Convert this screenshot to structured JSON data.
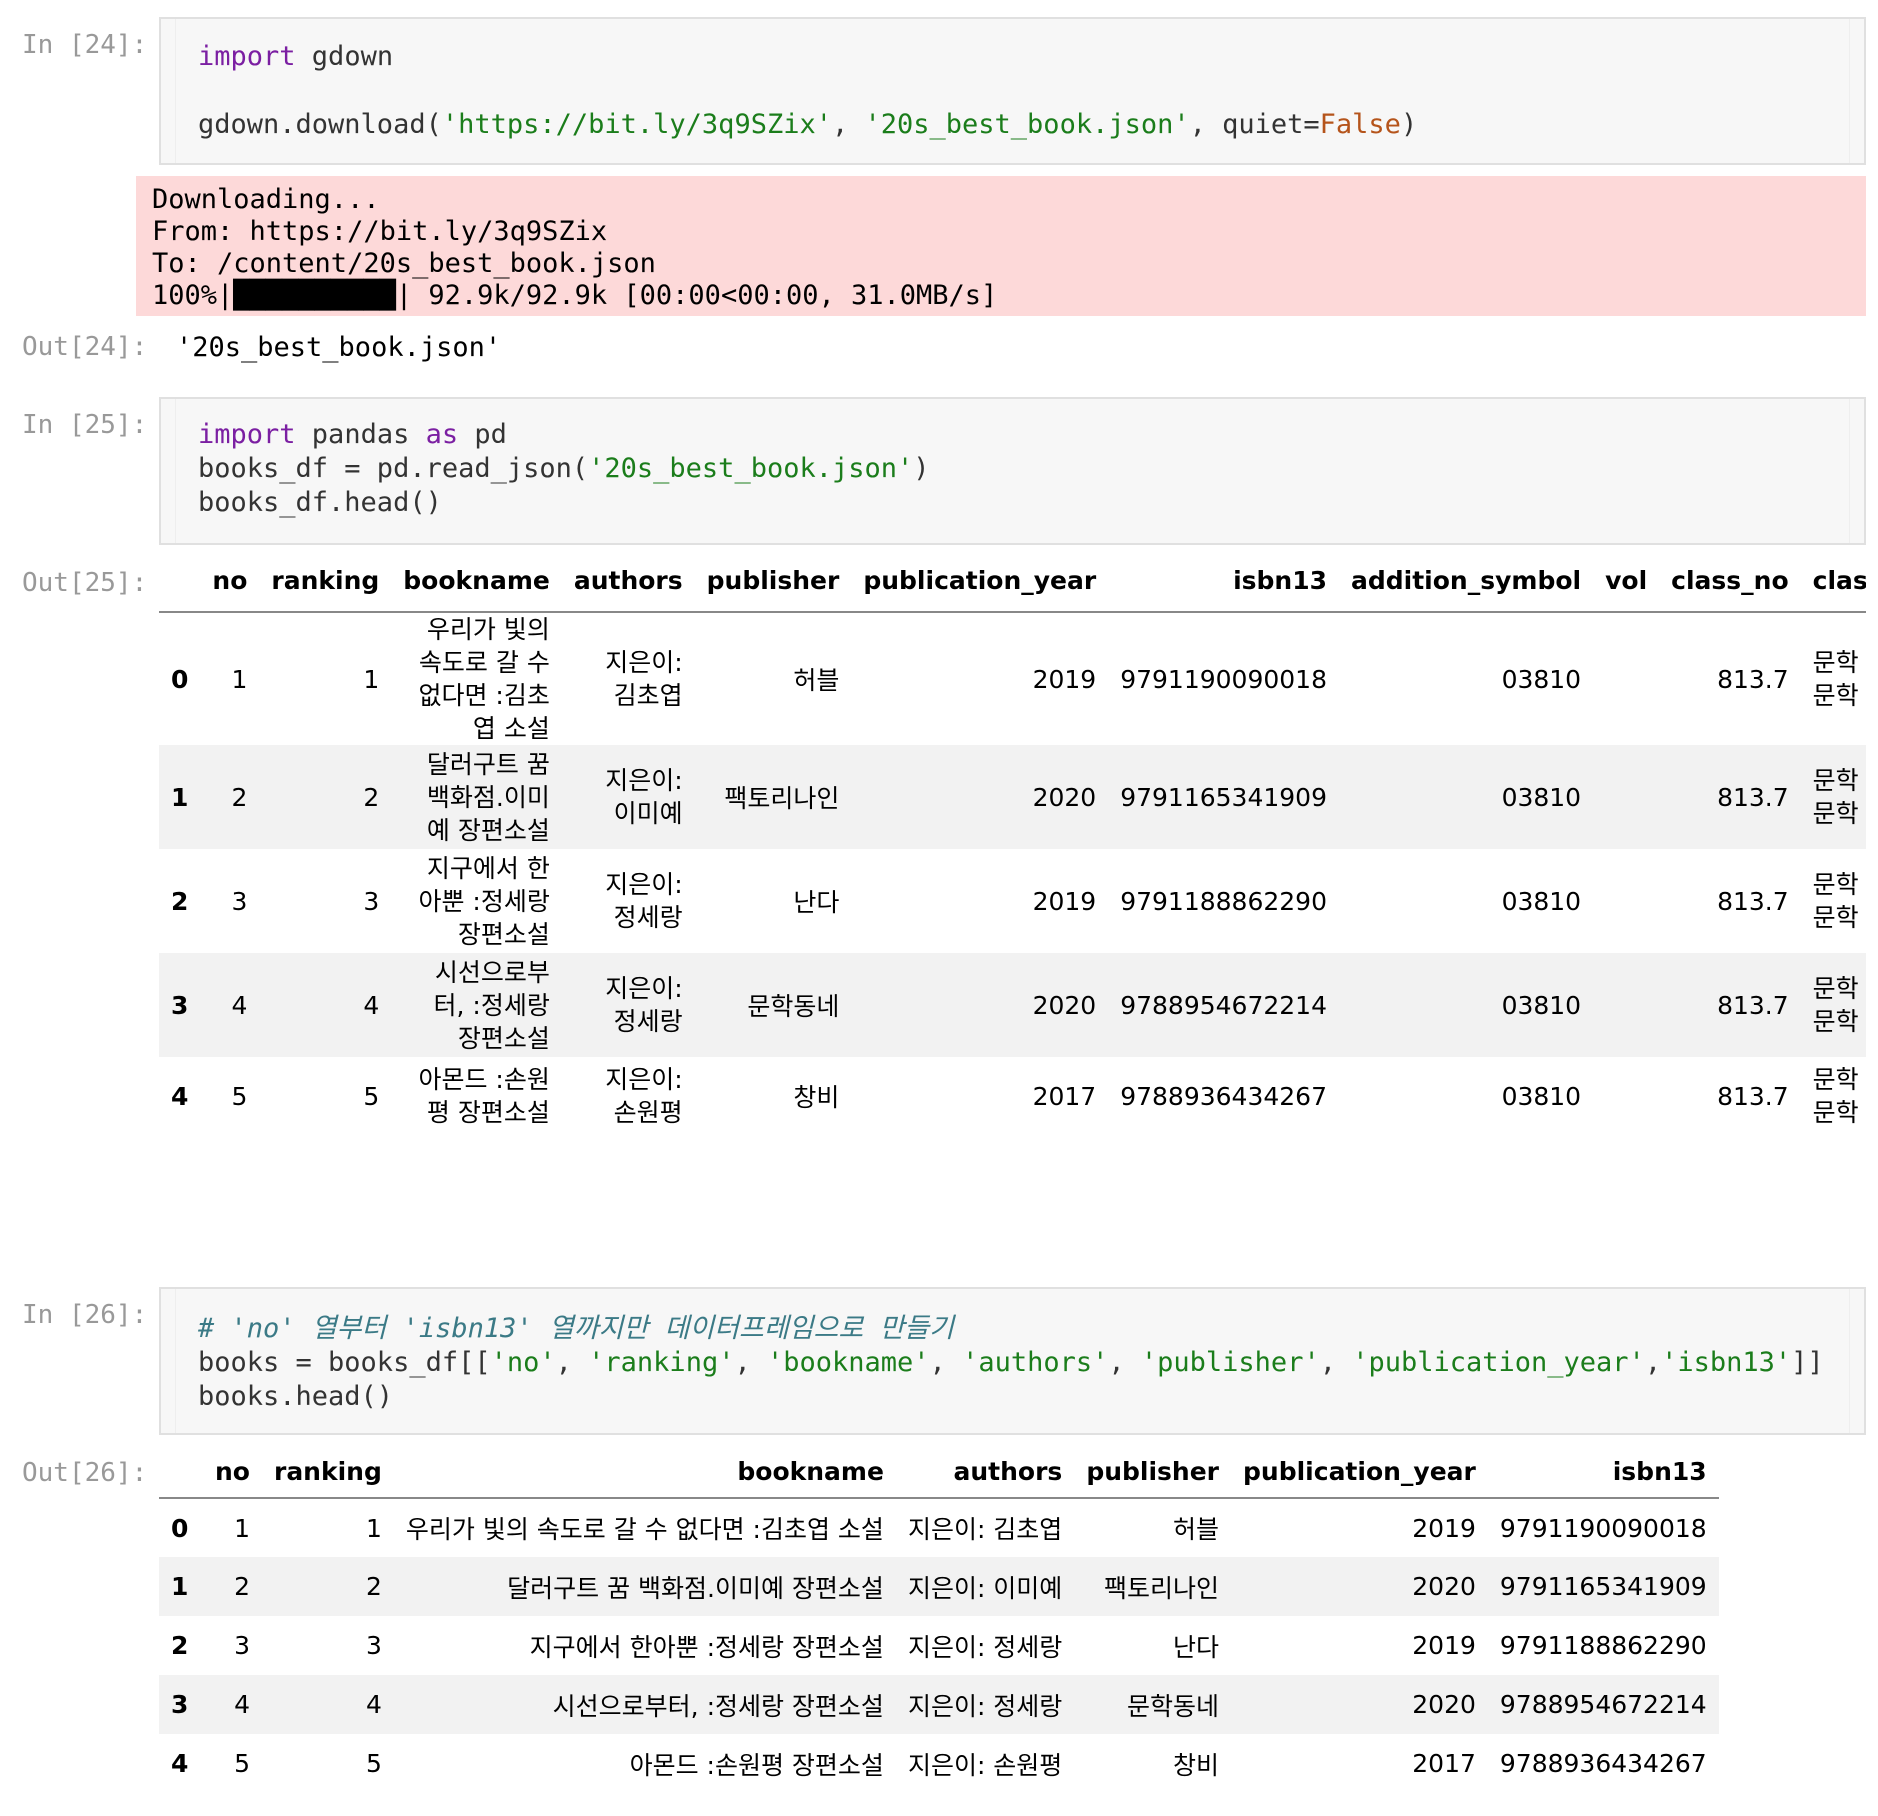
{
  "cell24": {
    "in_prompt": "In [24]:",
    "code_line1_kw": "import",
    "code_line1_rest": " gdown",
    "code_line2_pre": "gdown.download(",
    "code_line2_str1": "'https://bit.ly/3q9SZix'",
    "code_line2_mid": ", ",
    "code_line2_str2": "'20s_best_book.json'",
    "code_line2_mid2": ", quiet=",
    "code_line2_bool": "False",
    "code_line2_end": ")",
    "stderr": [
      "Downloading...",
      "From: https://bit.ly/3q9SZix",
      "To: /content/20s_best_book.json",
      "100%|██████████| 92.9k/92.9k [00:00<00:00, 31.0MB/s]"
    ],
    "out_prompt": "Out[24]:",
    "out_value": "'20s_best_book.json'"
  },
  "cell25": {
    "in_prompt": "In [25]:",
    "line1_kw1": "import",
    "line1_mid": " pandas ",
    "line1_kw2": "as",
    "line1_end": " pd",
    "line2_pre": "books_df = pd.read_json(",
    "line2_str": "'20s_best_book.json'",
    "line2_end": ")",
    "line3": "books_df.head()",
    "out_prompt": "Out[25]:",
    "table": {
      "columns": [
        "",
        "no",
        "ranking",
        "bookname",
        "authors",
        "publisher",
        "publication_year",
        "isbn13",
        "addition_symbol",
        "vol",
        "class_no",
        "class_n"
      ],
      "rows": [
        {
          "idx": "0",
          "no": "1",
          "ranking": "1",
          "bookname": [
            "우리가 빛의",
            "속도로 갈 수",
            "없다면 :김초",
            "엽 소설"
          ],
          "authors": [
            "지은이:",
            "김초엽"
          ],
          "publisher": "허블",
          "year": "2019",
          "isbn13": "9791190090018",
          "addition_symbol": "03810",
          "vol": "",
          "class_no": "813.7",
          "class_nm": [
            "문학 > 한",
            "문학 > 소"
          ]
        },
        {
          "idx": "1",
          "no": "2",
          "ranking": "2",
          "bookname": [
            "달러구트 꿈",
            "백화점.이미",
            "예 장편소설"
          ],
          "authors": [
            "지은이:",
            "이미예"
          ],
          "publisher": "팩토리나인",
          "year": "2020",
          "isbn13": "9791165341909",
          "addition_symbol": "03810",
          "vol": "",
          "class_no": "813.7",
          "class_nm": [
            "문학 > 한",
            "문학 > 소"
          ]
        },
        {
          "idx": "2",
          "no": "3",
          "ranking": "3",
          "bookname": [
            "지구에서 한",
            "아뿐 :정세랑",
            "장편소설"
          ],
          "authors": [
            "지은이:",
            "정세랑"
          ],
          "publisher": "난다",
          "year": "2019",
          "isbn13": "9791188862290",
          "addition_symbol": "03810",
          "vol": "",
          "class_no": "813.7",
          "class_nm": [
            "문학 > 한",
            "문학 > 소"
          ]
        },
        {
          "idx": "3",
          "no": "4",
          "ranking": "4",
          "bookname": [
            "시선으로부",
            "터, :정세랑",
            "장편소설"
          ],
          "authors": [
            "지은이:",
            "정세랑"
          ],
          "publisher": "문학동네",
          "year": "2020",
          "isbn13": "9788954672214",
          "addition_symbol": "03810",
          "vol": "",
          "class_no": "813.7",
          "class_nm": [
            "문학 > 한",
            "문학 > 소"
          ]
        },
        {
          "idx": "4",
          "no": "5",
          "ranking": "5",
          "bookname": [
            "아몬드 :손원",
            "평 장편소설"
          ],
          "authors": [
            "지은이:",
            "손원평"
          ],
          "publisher": "창비",
          "year": "2017",
          "isbn13": "9788936434267",
          "addition_symbol": "03810",
          "vol": "",
          "class_no": "813.7",
          "class_nm": [
            "문학 > 한",
            "문학 > 소"
          ]
        }
      ]
    }
  },
  "cell26": {
    "in_prompt": "In [26]:",
    "comment": "# 'no' 열부터 'isbn13' 열까지만 데이터프레임으로 만들기",
    "line2_pre": "books = books_df[[",
    "line2_items": [
      "'no'",
      "'ranking'",
      "'bookname'",
      "'authors'",
      "'publisher'",
      "'publication_year'",
      "'isbn13'"
    ],
    "line2_end": "]]",
    "line3": "books.head()",
    "out_prompt": "Out[26]:",
    "table": {
      "columns": [
        "",
        "no",
        "ranking",
        "bookname",
        "authors",
        "publisher",
        "publication_year",
        "isbn13"
      ],
      "rows": [
        [
          "0",
          "1",
          "1",
          "우리가 빛의 속도로 갈 수 없다면 :김초엽 소설",
          "지은이: 김초엽",
          "허블",
          "2019",
          "9791190090018"
        ],
        [
          "1",
          "2",
          "2",
          "달러구트 꿈 백화점.이미예 장편소설",
          "지은이: 이미예",
          "팩토리나인",
          "2020",
          "9791165341909"
        ],
        [
          "2",
          "3",
          "3",
          "지구에서 한아뿐 :정세랑 장편소설",
          "지은이: 정세랑",
          "난다",
          "2019",
          "9791188862290"
        ],
        [
          "3",
          "4",
          "4",
          "시선으로부터, :정세랑 장편소설",
          "지은이: 정세랑",
          "문학동네",
          "2020",
          "9788954672214"
        ],
        [
          "4",
          "5",
          "5",
          "아몬드 :손원평 장편소설",
          "지은이: 손원평",
          "창비",
          "2017",
          "9788936434267"
        ]
      ]
    }
  }
}
